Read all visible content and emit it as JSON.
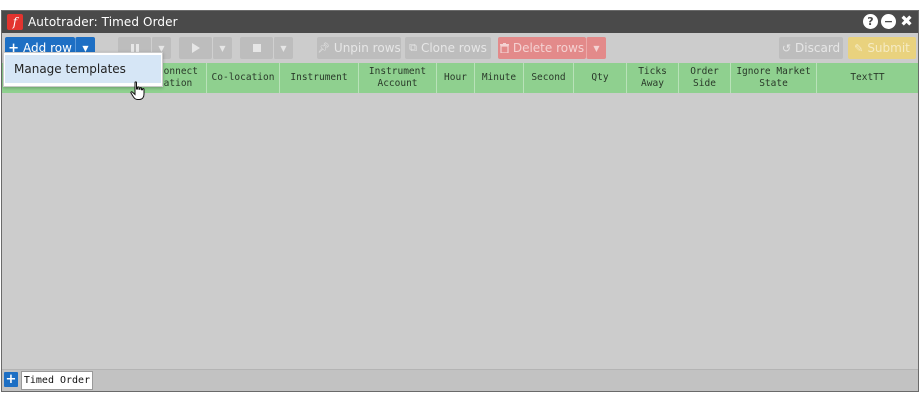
{
  "window": {
    "title": "Autotrader: Timed Order",
    "logo_glyph": "𝑓"
  },
  "title_controls": {
    "help": "?",
    "minimize": "−",
    "close": "✖"
  },
  "toolbar": {
    "add_row": "Add row",
    "unpin_rows": "Unpin rows",
    "clone_rows": "Clone rows",
    "delete_rows": "Delete rows",
    "discard": "Discard",
    "submit": "Submit"
  },
  "dropdown": {
    "items": [
      "Manage templates"
    ]
  },
  "columns": [
    "Connect\nation",
    "Co-location",
    "Instrument",
    "Instrument\nAccount",
    "Hour",
    "Minute",
    "Second",
    "Qty",
    "Ticks\nAway",
    "Order\nSide",
    "Ignore Market\nState",
    "TextTT"
  ],
  "tabs": [
    {
      "label": "Timed Order"
    }
  ],
  "colors": {
    "accent": "#1d6fc4",
    "header_green": "#8fd08f",
    "titlebar": "#4a4a4a",
    "body_bg": "#cccccc"
  },
  "icons": [
    "plus-icon",
    "caret-down-icon",
    "pause-icon",
    "play-icon",
    "stop-icon",
    "pin-icon",
    "copy-icon",
    "trash-icon",
    "undo-icon",
    "pencil-icon",
    "help-icon",
    "minimize-icon",
    "close-icon",
    "hand-cursor-icon"
  ]
}
